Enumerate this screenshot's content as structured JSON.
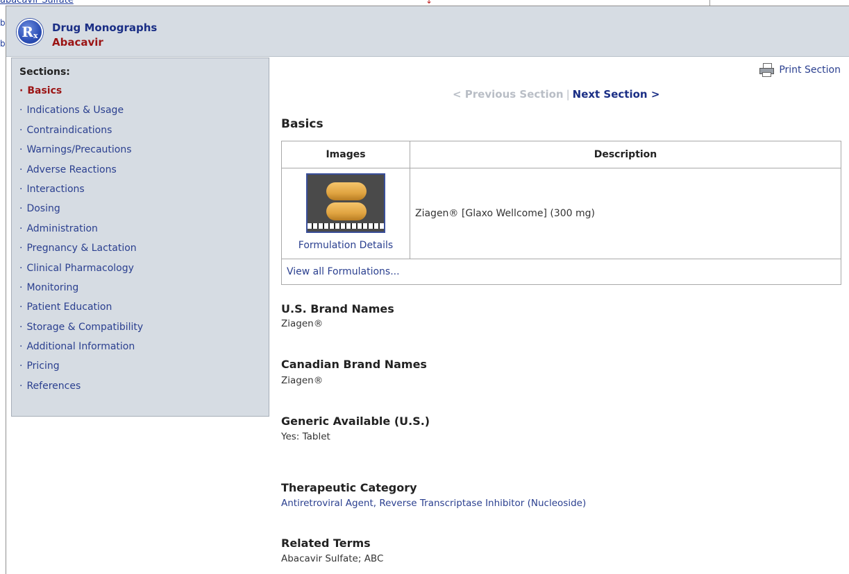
{
  "background": {
    "top_link": "abacavir Sulfate",
    "left_fragments": [
      "b",
      "b"
    ]
  },
  "header": {
    "app_name": "Drug Monographs",
    "drug_name": "Abacavir",
    "logo_text": "R",
    "logo_sub": "x"
  },
  "sidebar": {
    "heading": "Sections:",
    "bullet": "·",
    "items": [
      {
        "label": "Basics",
        "active": true
      },
      {
        "label": "Indications & Usage"
      },
      {
        "label": "Contraindications"
      },
      {
        "label": "Warnings/Precautions"
      },
      {
        "label": "Adverse Reactions"
      },
      {
        "label": "Interactions"
      },
      {
        "label": "Dosing"
      },
      {
        "label": "Administration"
      },
      {
        "label": "Pregnancy & Lactation"
      },
      {
        "label": "Clinical Pharmacology"
      },
      {
        "label": "Monitoring"
      },
      {
        "label": "Patient Education"
      },
      {
        "label": "Storage & Compatibility"
      },
      {
        "label": "Additional Information"
      },
      {
        "label": "Pricing"
      },
      {
        "label": "References"
      }
    ]
  },
  "toolbar": {
    "print_label": "Print Section",
    "prev_label": "< Previous Section",
    "separator": "|",
    "next_label": "Next Section >"
  },
  "main": {
    "section_title": "Basics",
    "table": {
      "col_images": "Images",
      "col_description": "Description",
      "formulation_details": "Formulation Details",
      "description": "Ziagen® [Glaxo Wellcome] (300 mg)",
      "view_all": "View all Formulations..."
    },
    "fields": {
      "us_brand_label": "U.S. Brand Names",
      "us_brand_value": "Ziagen®",
      "ca_brand_label": "Canadian Brand Names",
      "ca_brand_value": "Ziagen®",
      "generic_label": "Generic Available (U.S.)",
      "generic_value": "Yes: Tablet",
      "category_label": "Therapeutic Category",
      "category_value": "Antiretroviral Agent, Reverse Transcriptase Inhibitor (Nucleoside)",
      "related_label": "Related Terms",
      "related_value": "Abacavir Sulfate; ABC"
    }
  },
  "colors": {
    "header_bg": "#d6dce3",
    "link": "#2a3f8f",
    "active": "#9b1414",
    "nav_disabled": "#b9bec6"
  }
}
